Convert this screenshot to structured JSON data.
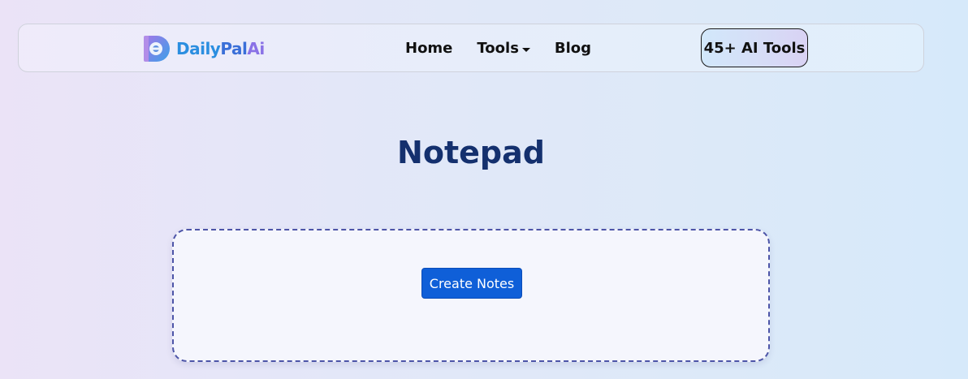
{
  "brand": {
    "name_part1": "Daily",
    "name_part2": "Pal",
    "name_part3": "Ai",
    "logo_icon": "dailypal-logo-icon",
    "colors": {
      "daily": "#2b8ee0",
      "pal": "#3a6fd8",
      "ai": "#8a72e6"
    }
  },
  "nav": {
    "items": [
      {
        "label": "Home"
      },
      {
        "label": "Tools",
        "has_dropdown": true
      },
      {
        "label": "Blog"
      }
    ],
    "tools_badge": "45+ AI Tools"
  },
  "page": {
    "title": "Notepad",
    "title_color": "#14306e"
  },
  "notes": {
    "create_button": "Create Notes",
    "button_color": "#0f5fd8",
    "border_color": "#4d55a8"
  }
}
